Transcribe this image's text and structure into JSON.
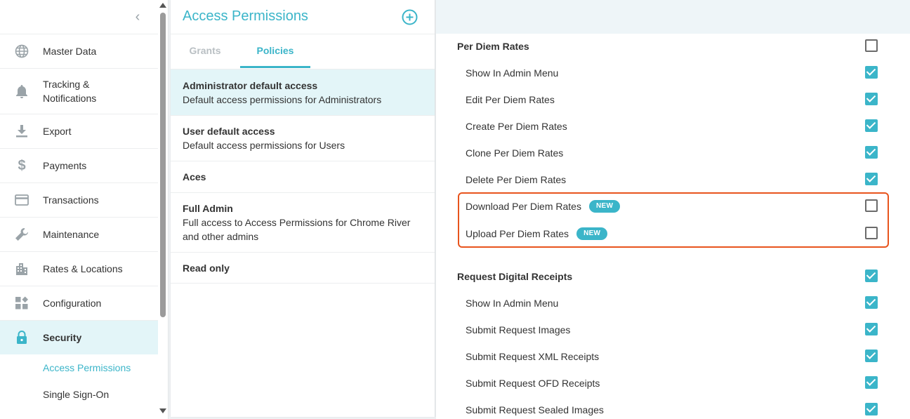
{
  "sidebar": {
    "items": [
      {
        "label": "Master Data",
        "icon": "globe-icon"
      },
      {
        "label": "Tracking & Notifications",
        "icon": "bell-icon"
      },
      {
        "label": "Export",
        "icon": "download-icon"
      },
      {
        "label": "Payments",
        "icon": "dollar-icon"
      },
      {
        "label": "Transactions",
        "icon": "credit-card-icon"
      },
      {
        "label": "Maintenance",
        "icon": "wrench-icon"
      },
      {
        "label": "Rates & Locations",
        "icon": "buildings-icon"
      },
      {
        "label": "Configuration",
        "icon": "widgets-icon"
      },
      {
        "label": "Security",
        "icon": "lock-icon"
      }
    ],
    "subitems": [
      "Access Permissions",
      "Single Sign-On"
    ]
  },
  "middle": {
    "title": "Access Permissions",
    "tabs": [
      "Grants",
      "Policies"
    ],
    "policies": [
      {
        "name": "Administrator default access",
        "desc": "Default access permissions for Administrators"
      },
      {
        "name": "User default access",
        "desc": "Default access permissions for Users"
      },
      {
        "name": "Aces",
        "desc": ""
      },
      {
        "name": "Full Admin",
        "desc": "Full access to Access Permissions for Chrome River and other admins"
      },
      {
        "name": "Read only",
        "desc": ""
      }
    ]
  },
  "permissions": [
    {
      "label": "Per Diem Rates",
      "group": true,
      "checked": false
    },
    {
      "label": "Show In Admin Menu",
      "group": false,
      "checked": true
    },
    {
      "label": "Edit Per Diem Rates",
      "group": false,
      "checked": true
    },
    {
      "label": "Create Per Diem Rates",
      "group": false,
      "checked": true
    },
    {
      "label": "Clone Per Diem Rates",
      "group": false,
      "checked": true
    },
    {
      "label": "Delete Per Diem Rates",
      "group": false,
      "checked": true
    },
    {
      "label": "Download Per Diem Rates",
      "group": false,
      "checked": false,
      "badge": "NEW"
    },
    {
      "label": "Upload Per Diem Rates",
      "group": false,
      "checked": false,
      "badge": "NEW"
    },
    {
      "label": "Request Digital Receipts",
      "group": true,
      "checked": true
    },
    {
      "label": "Show In Admin Menu",
      "group": false,
      "checked": true
    },
    {
      "label": "Submit Request Images",
      "group": false,
      "checked": true
    },
    {
      "label": "Submit Request XML Receipts",
      "group": false,
      "checked": true
    },
    {
      "label": "Submit Request OFD Receipts",
      "group": false,
      "checked": true
    },
    {
      "label": "Submit Request Sealed Images",
      "group": false,
      "checked": true
    }
  ],
  "colors": {
    "accent": "#3bb5c9",
    "highlight": "#e8541d"
  }
}
